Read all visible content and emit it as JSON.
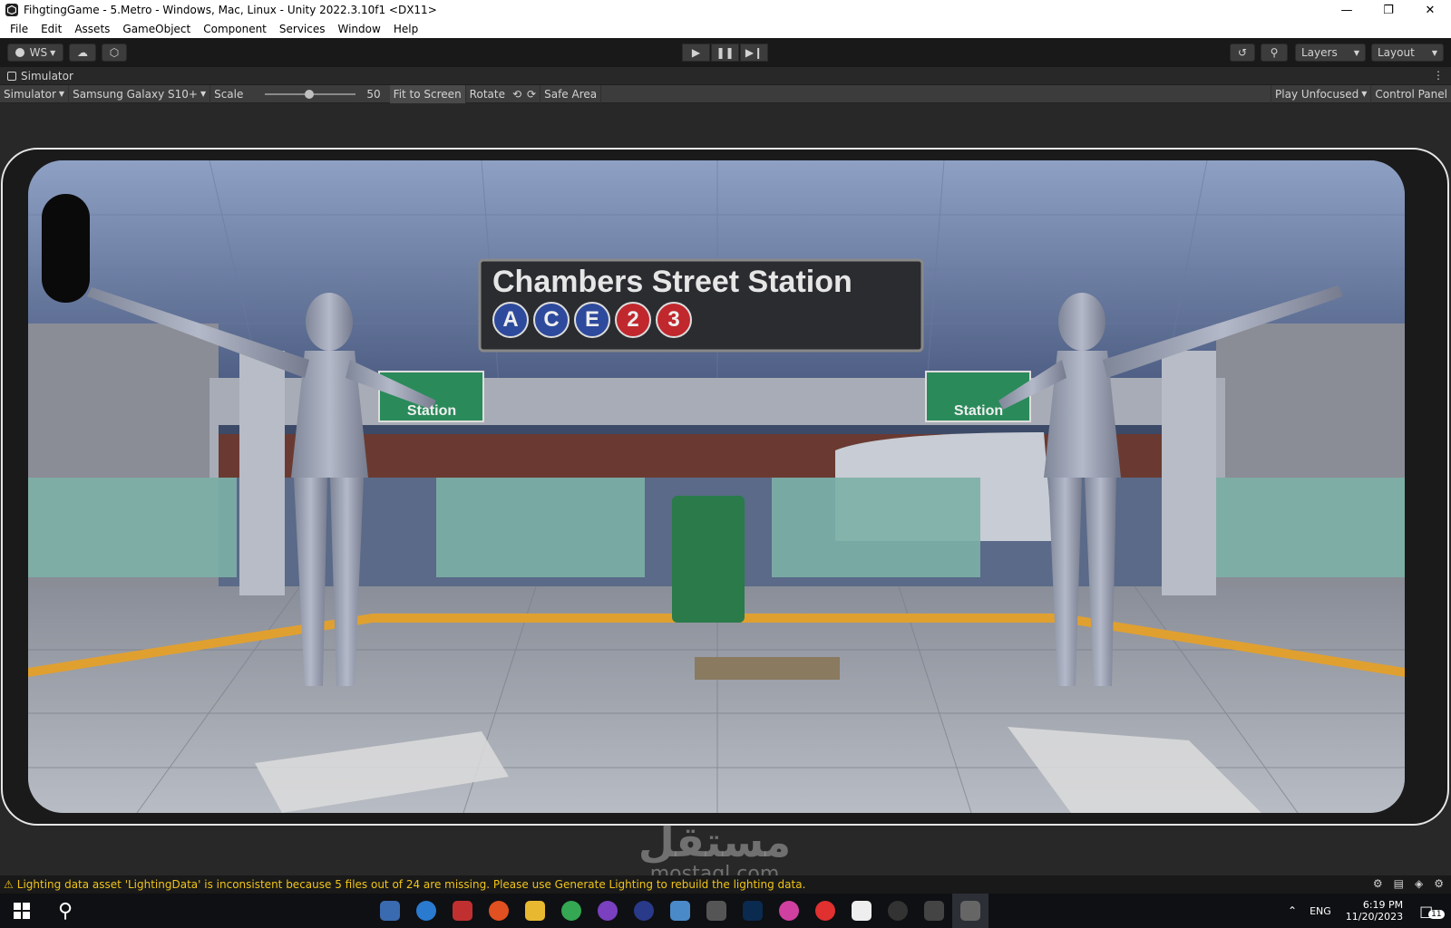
{
  "window": {
    "title": "FihgtingGame - 5.Metro - Windows, Mac, Linux - Unity 2022.3.10f1 <DX11>"
  },
  "menu": [
    "File",
    "Edit",
    "Assets",
    "GameObject",
    "Component",
    "Services",
    "Window",
    "Help"
  ],
  "toolbar": {
    "account_label": "WS",
    "layers_label": "Layers",
    "layout_label": "Layout"
  },
  "tab": {
    "label": "Simulator"
  },
  "simulator": {
    "mode": "Simulator",
    "device": "Samsung Galaxy S10+",
    "scale_label": "Scale",
    "scale_value": "50",
    "fit_label": "Fit to Screen",
    "rotate_label": "Rotate",
    "safe_area_label": "Safe Area",
    "play_mode": "Play Unfocused",
    "control_panel": "Control Panel"
  },
  "scene": {
    "sign_title": "Chambers Street Station",
    "sign_lines": [
      {
        "letter": "A",
        "color": "#2e4a9c"
      },
      {
        "letter": "C",
        "color": "#2e4a9c"
      },
      {
        "letter": "E",
        "color": "#2e4a9c"
      },
      {
        "letter": "2",
        "color": "#c0282e"
      },
      {
        "letter": "3",
        "color": "#c0282e"
      }
    ],
    "station_sign_left": "Station",
    "station_sign_right": "Station"
  },
  "status": {
    "message": "Lighting data asset 'LightingData' is inconsistent because 5 files out of 24 are missing. Please use Generate Lighting to rebuild the lighting data."
  },
  "taskbar": {
    "lang": "ENG",
    "time": "6:19 PM",
    "date": "11/20/2023",
    "notifications": "11"
  },
  "watermark": {
    "arabic": "مستقل",
    "latin": "mostaql.com"
  }
}
